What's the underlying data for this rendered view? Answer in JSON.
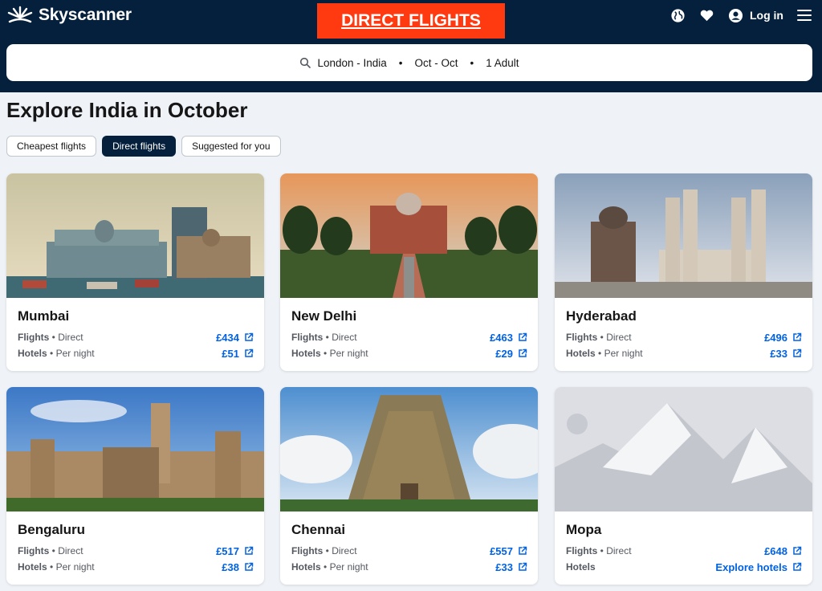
{
  "header": {
    "logo_text": "Skyscanner",
    "banner": "DIRECT FLIGHTS",
    "login_label": "Log in"
  },
  "search": {
    "route": "London - India",
    "dates": "Oct - Oct",
    "travellers": "1 Adult"
  },
  "page": {
    "title": "Explore India in October"
  },
  "filters": [
    {
      "label": "Cheapest flights",
      "active": false
    },
    {
      "label": "Direct flights",
      "active": true
    },
    {
      "label": "Suggested for you",
      "active": false
    }
  ],
  "row_labels": {
    "flights": "Flights",
    "hotels": "Hotels",
    "sep": " • ",
    "direct": "Direct",
    "per_night": "Per night"
  },
  "cards": [
    {
      "city": "Mumbai",
      "flight_price": "£434",
      "hotel_price": "£51"
    },
    {
      "city": "New Delhi",
      "flight_price": "£463",
      "hotel_price": "£29"
    },
    {
      "city": "Hyderabad",
      "flight_price": "£496",
      "hotel_price": "£33"
    },
    {
      "city": "Bengaluru",
      "flight_price": "£517",
      "hotel_price": "£38"
    },
    {
      "city": "Chennai",
      "flight_price": "£557",
      "hotel_price": "£33"
    },
    {
      "city": "Mopa",
      "flight_price": "£648",
      "hotel_price": "Explore hotels"
    }
  ],
  "colors": {
    "navy": "#05203c",
    "banner_red": "#ff3a10",
    "link_blue": "#0062e3"
  }
}
